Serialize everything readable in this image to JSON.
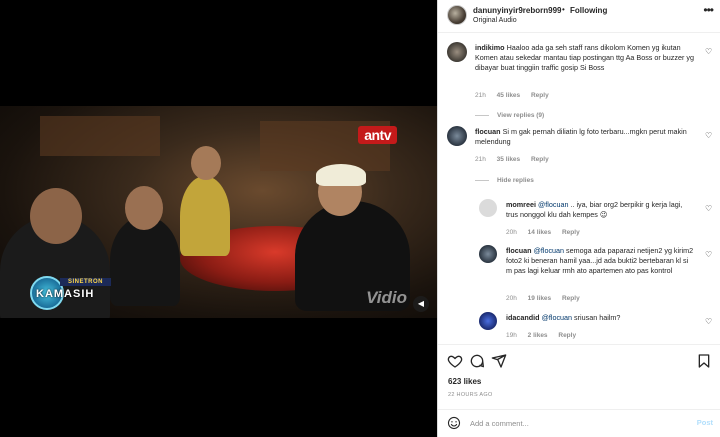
{
  "video": {
    "channel_logo": "antv",
    "watermark": "Vidio",
    "badge_label": "SINETRON",
    "badge_title": "KAMASIH",
    "volume_icon": "volume-icon"
  },
  "header": {
    "username": "danunyinyir9reborn999",
    "separator": "•",
    "follow_status": "Following",
    "audio": "Original Audio",
    "more_icon": "more-horizontal-icon"
  },
  "comments": [
    {
      "username": "indikimo",
      "text": "Haaloo ada ga seh staff rans dikolom Komen yg ikutan Komen atau sekedar mantau tiap postingan ttg Aa Boss or buzzer yg dibayar buat tinggiin traffic gosip Si Boss",
      "time": "21h",
      "likes": "45 likes",
      "reply": "Reply",
      "replies_toggle": "View replies (9)"
    },
    {
      "username": "flocuan",
      "text": "Si m gak pernah diliatin lg foto terbaru...mgkn perut makin melendung",
      "time": "21h",
      "likes": "35 likes",
      "reply": "Reply",
      "replies_toggle": "Hide replies"
    },
    {
      "username": "momreei",
      "mention": "@flocuan",
      "text": ".. iya, biar org2 berpikir g kerja lagi, trus nonggol klu dah kempes 😉",
      "time": "20h",
      "likes": "14 likes",
      "reply": "Reply"
    },
    {
      "username": "flocuan",
      "mention": "@flocuan",
      "text": "semoga ada paparazi netijen2 yg kirim2 foto2 ki beneran hamil yaa...jd ada bukti2 bertebaran kl si m pas lagi keluar rmh ato apartemen ato pas kontrol",
      "time": "20h",
      "likes": "19 likes",
      "reply": "Reply"
    },
    {
      "username": "idacandid",
      "mention": "@flocuan",
      "text": "sriusan hailm?",
      "time": "19h",
      "likes": "2 likes",
      "reply": "Reply"
    }
  ],
  "actions": {
    "like_icon": "heart-icon",
    "comment_icon": "comment-icon",
    "share_icon": "share-icon",
    "save_icon": "bookmark-icon"
  },
  "likes_count": "623 likes",
  "post_time": "22 HOURS AGO",
  "add_comment": {
    "placeholder": "Add a comment...",
    "post_label": "Post",
    "emoji_icon": "emoji-icon"
  },
  "colors": {
    "accent": "#0095f6",
    "post_disabled": "#b2dffc",
    "text": "#262626",
    "muted": "#8e8e8e"
  }
}
